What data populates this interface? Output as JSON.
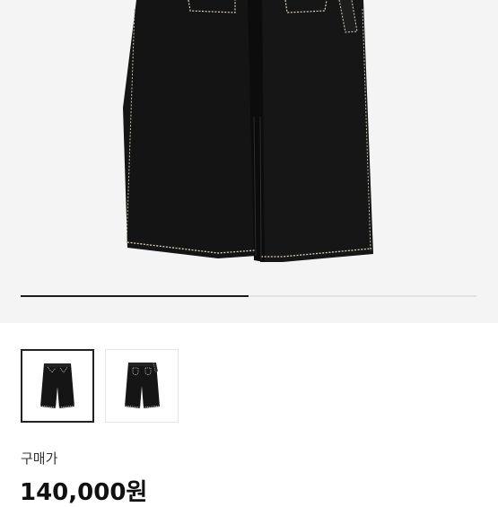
{
  "gallery": {
    "current_index": 1,
    "total": 2,
    "progress_fraction": 0.5
  },
  "thumbnails": [
    {
      "name": "thumb-front",
      "selected": true
    },
    {
      "name": "thumb-back",
      "selected": false
    }
  ],
  "product": {
    "price_label": "구매가",
    "price": "140,000원"
  },
  "colors": {
    "hero_bg": "#f4f4f4",
    "denim": "#141414",
    "stitch": "#d9d0b8",
    "progress_active": "#1b1b1b",
    "progress_track": "#e2e2e2"
  },
  "icons": {
    "product_image": "black-jeans-image"
  }
}
